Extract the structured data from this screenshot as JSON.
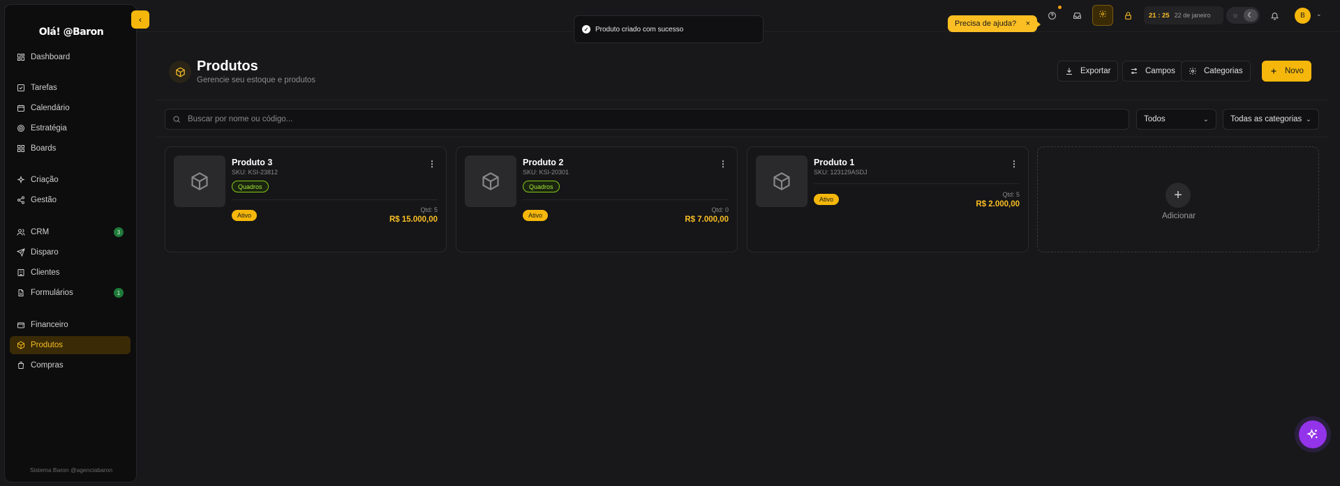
{
  "sidebar": {
    "title": "Olá! @Baron",
    "items": [
      {
        "label": "Dashboard",
        "icon": "dashboard-icon"
      },
      {
        "label": "Tarefas",
        "icon": "checkbox-icon"
      },
      {
        "label": "Calendário",
        "icon": "calendar-icon"
      },
      {
        "label": "Estratégia",
        "icon": "target-icon"
      },
      {
        "label": "Boards",
        "icon": "boards-icon"
      },
      {
        "label": "Criação",
        "icon": "sparkle-icon"
      },
      {
        "label": "Gestão",
        "icon": "share-icon"
      },
      {
        "label": "CRM",
        "icon": "users-icon",
        "badge": "3"
      },
      {
        "label": "Disparo",
        "icon": "send-icon"
      },
      {
        "label": "Clientes",
        "icon": "building-icon"
      },
      {
        "label": "Formulários",
        "icon": "file-icon",
        "badge": "1"
      },
      {
        "label": "Financeiro",
        "icon": "wallet-icon"
      },
      {
        "label": "Produtos",
        "icon": "package-icon",
        "active": true
      },
      {
        "label": "Compras",
        "icon": "bag-icon"
      }
    ],
    "footer": "Sistema Baron @agenciabaron"
  },
  "toast": {
    "message": "Produto criado com sucesso"
  },
  "topbar": {
    "help_label": "Precisa de ajuda?",
    "help_close": "×",
    "clock_time": "21 : 25",
    "clock_date": "22 de janeiro",
    "avatar_initial": "B"
  },
  "header": {
    "title": "Produtos",
    "subtitle": "Gerencie seu estoque e produtos",
    "export_label": "Exportar",
    "fields_label": "Campos",
    "categories_label": "Categorias",
    "new_label": "Novo"
  },
  "filters": {
    "search_placeholder": "Buscar por nome ou código...",
    "status_value": "Todos",
    "category_value": "Todas as categorias"
  },
  "products": [
    {
      "name": "Produto 3",
      "sku": "SKU: KSI-23812",
      "category": "Quadros",
      "status": "Ativo",
      "qty": "Qtd: 5",
      "price": "R$ 15.000,00"
    },
    {
      "name": "Produto 2",
      "sku": "SKU: KSI-20301",
      "category": "Quadros",
      "status": "Ativo",
      "qty": "Qtd: 0",
      "price": "R$ 7.000,00"
    },
    {
      "name": "Produto 1",
      "sku": "SKU: 123129ASDJ",
      "category": "",
      "status": "Ativo",
      "qty": "Qtd: 5",
      "price": "R$ 2.000,00"
    }
  ],
  "add_card": {
    "label": "Adicionar"
  },
  "colors": {
    "accent": "#f5b70b",
    "background": "#18181a",
    "tag_green": "#84cc16",
    "ai_purple": "#9333ea"
  }
}
